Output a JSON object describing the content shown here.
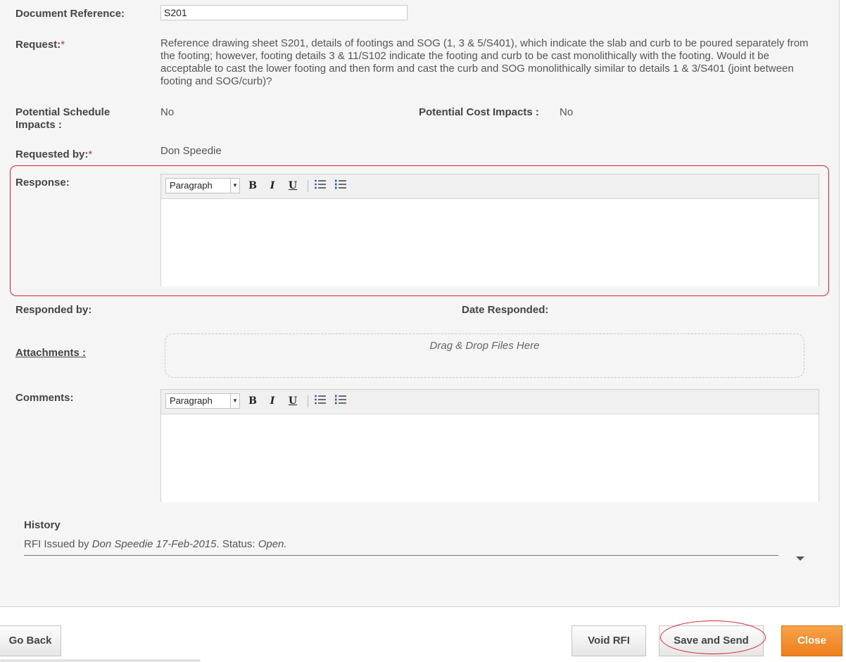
{
  "form": {
    "doc_ref_label": "Document Reference:",
    "doc_ref_value": "S201",
    "request_label": "Request:",
    "required_mark": "*",
    "request_text": "Reference drawing sheet S201, details of footings and SOG (1, 3 & 5/S401), which indicate the slab and curb to be poured separately from the footing; however, footing details 3 & 11/S102 indicate the footing and curb to be cast monolithically with the footing. Would it be acceptable to cast the lower footing and then form and cast the curb and SOG monolithically similar to details 1 & 3/S401 (joint between footing and SOG/curb)?",
    "schedule_label_1": "Potential Schedule",
    "schedule_label_2": "Impacts :",
    "schedule_value": "No",
    "cost_label": "Potential Cost Impacts :",
    "cost_value": "No",
    "requested_by_label": "Requested by:",
    "requested_by_value": "Don Speedie",
    "response_label": "Response:",
    "responded_by_label": "Responded by:",
    "date_responded_label": "Date Responded:",
    "attachments_label": "Attachments :",
    "dropzone_text": "Drag & Drop Files Here",
    "comments_label": "Comments:"
  },
  "editor": {
    "format_value": "Paragraph",
    "bold_glyph": "B",
    "italic_glyph": "I",
    "underline_glyph": "U"
  },
  "history": {
    "title": "History",
    "prefix": "RFI Issued by ",
    "user_date": "Don Speedie 17-Feb-2015",
    "status_prefix": ". Status: ",
    "status": "Open."
  },
  "buttons": {
    "go_back": "Go Back",
    "void": "Void RFI",
    "save_send": "Save and Send",
    "close": "Close"
  },
  "colors": {
    "close_orange": "#ee7f1c",
    "annotation_red": "#d9232d"
  }
}
